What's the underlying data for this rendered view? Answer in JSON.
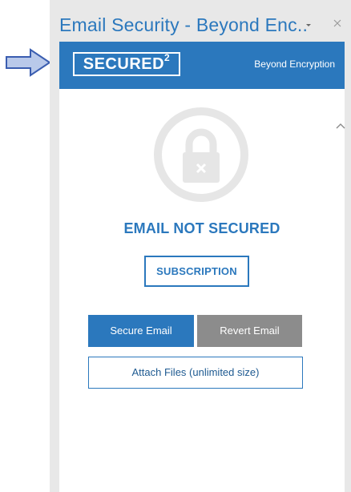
{
  "pane": {
    "title": "Email Security - Beyond Enc..",
    "menu_icon": "caret-down-icon",
    "close_icon": "close-icon"
  },
  "header": {
    "logo_text": "SECURED",
    "logo_superscript": "2",
    "brand": "Beyond Encryption"
  },
  "status": {
    "icon": "lock-icon",
    "title": "EMAIL NOT SECURED"
  },
  "buttons": {
    "subscription": "SUBSCRIPTION",
    "secure": "Secure Email",
    "revert": "Revert Email",
    "attach": "Attach Files (unlimited size)"
  },
  "annotation": {
    "icon": "arrow-right-icon"
  },
  "colors": {
    "accent": "#2b78bd",
    "revert": "#8c8c8c",
    "pane_bg": "#e8e8e8",
    "lock": "#e6e6e6"
  }
}
